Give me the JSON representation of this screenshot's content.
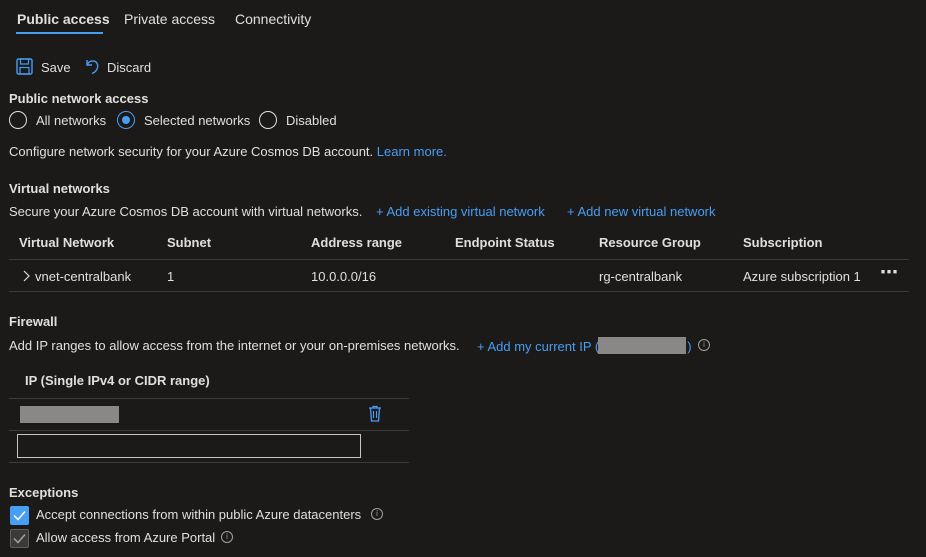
{
  "tabs": [
    {
      "label": "Public access"
    },
    {
      "label": "Private access"
    },
    {
      "label": "Connectivity"
    }
  ],
  "toolbar": {
    "save_label": "Save",
    "discard_label": "Discard"
  },
  "public_network_access": {
    "heading": "Public network access",
    "options": [
      {
        "label": "All networks",
        "selected": false
      },
      {
        "label": "Selected networks",
        "selected": true
      },
      {
        "label": "Disabled",
        "selected": false
      }
    ],
    "description": "Configure network security for your Azure Cosmos DB account.",
    "learn_more": "Learn more."
  },
  "virtual_networks": {
    "heading": "Virtual networks",
    "description": "Secure your Azure Cosmos DB account with virtual networks.",
    "add_existing": "+ Add existing virtual network",
    "add_new": "+ Add new virtual network",
    "columns": [
      "Virtual Network",
      "Subnet",
      "Address range",
      "Endpoint Status",
      "Resource Group",
      "Subscription"
    ],
    "rows": [
      {
        "vnet": "vnet-centralbank",
        "subnet": "1",
        "address_range": "10.0.0.0/16",
        "endpoint_status": "",
        "resource_group": "rg-centralbank",
        "subscription": "Azure subscription 1"
      }
    ],
    "more_label": "⋯"
  },
  "firewall": {
    "heading": "Firewall",
    "description": "Add IP ranges to allow access from the internet or your on-premises networks.",
    "add_ip": "+ Add my current IP (",
    "add_ip_close": ")",
    "ip_column": "IP (Single IPv4 or CIDR range)",
    "ip_input_value": ""
  },
  "exceptions": {
    "heading": "Exceptions",
    "items": [
      {
        "label": "Accept connections from within public Azure datacenters",
        "checked": true
      },
      {
        "label": "Allow access from Azure Portal",
        "checked": true,
        "disabled": true
      }
    ]
  },
  "colors": {
    "accent": "#479ef5",
    "background": "#1b1a19",
    "text": "#e1dfdd"
  }
}
